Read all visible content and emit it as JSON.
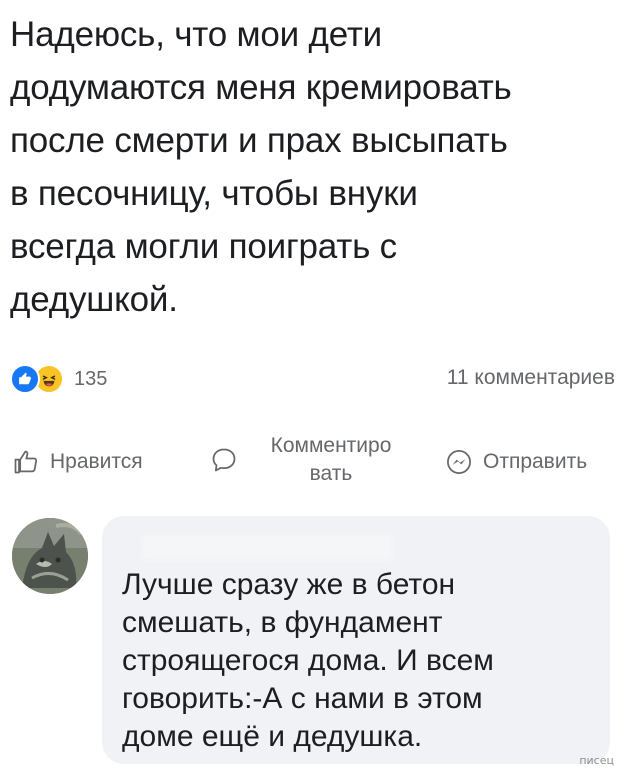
{
  "post": {
    "text_lines": [
      "Надеюсь, что мои дети",
      "додумаются меня кремировать",
      "после смерти и прах высыпать",
      "в песочницу, чтобы внуки",
      "всегда могли поиграть с",
      "дедушкой."
    ]
  },
  "stats": {
    "reactions": [
      "like",
      "haha"
    ],
    "reaction_count": "135",
    "comments_count": "11 комментариев"
  },
  "actions": {
    "like_label": "Нравится",
    "comment_label": "Комментиро вать",
    "share_label": "Отправить"
  },
  "comment": {
    "author": "",
    "text_lines": [
      "Лучше сразу же в бетон",
      "смешать, в фундамент",
      "строящегося дома. И всем",
      "говорить:-А с нами в этом",
      "доме ещё и дедушка."
    ]
  },
  "watermark": "писец",
  "colors": {
    "like_blue": "#1877f2",
    "haha_yellow": "#f7c325",
    "muted_text": "#65676b",
    "bubble_bg": "#f0f2f5"
  },
  "icons": [
    "thumbs-up-icon",
    "haha-icon",
    "comment-icon",
    "messenger-icon"
  ]
}
